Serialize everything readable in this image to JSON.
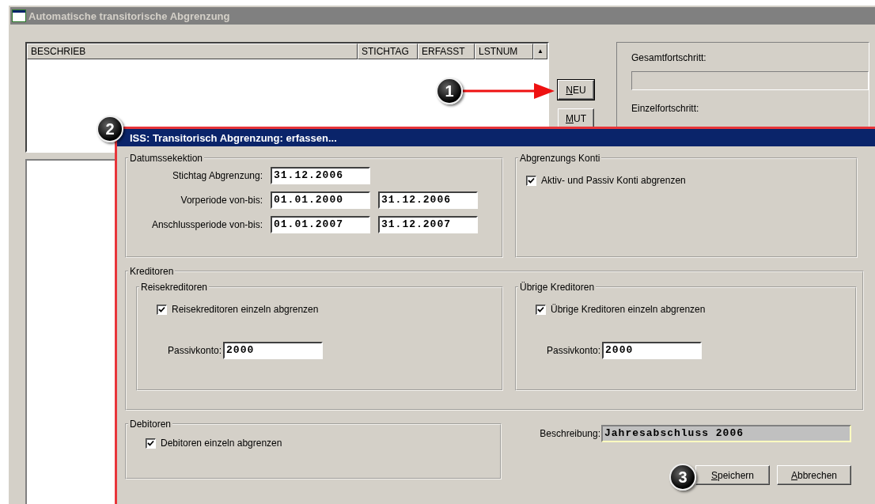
{
  "window": {
    "title": "Automatische transitorische Abgrenzung",
    "active": false
  },
  "list": {
    "columns": [
      "BESCHRIEB",
      "STICHTAG",
      "ERFASST",
      "LSTNUM"
    ],
    "scroll_up": "▲"
  },
  "side_buttons": [
    {
      "label": "NEU",
      "default": true
    },
    {
      "label": "MUT",
      "default": false
    }
  ],
  "progress": [
    {
      "label": "Gesamtfortschritt:",
      "level": 0
    },
    {
      "label": "Einzelfortschritt:"
    }
  ],
  "dialog": {
    "title": "ISS: Transitorisch Abgrenzung: erfassen...",
    "active": true,
    "dates": {
      "label": "Datumssekektion",
      "rows": [
        {
          "label": "Stichtag Abgrenzung:",
          "values": [
            "31.12.2006"
          ]
        },
        {
          "label": "Vorperiode von-bis:",
          "values": [
            "01.01.2000",
            "31.12.2006"
          ]
        },
        {
          "label": "Anschlussperiode von-bis:",
          "values": [
            "01.01.2007",
            "31.12.2007"
          ]
        }
      ]
    },
    "konti": {
      "label": "Abgrenzungs Konti",
      "checkbox": {
        "label": "Aktiv- und Passiv Konti abgrenzen",
        "checked": true
      }
    },
    "kreditoren": {
      "label": "Kreditoren",
      "groups": [
        {
          "label": "Reisekreditoren",
          "checkbox": {
            "label": "Reisekreditoren einzeln abgrenzen",
            "checked": true
          },
          "account_label": "Passivkonto:",
          "account": "2000"
        },
        {
          "label": "Übrige Kreditoren",
          "checkbox": {
            "label": "Übrige Kreditoren einzeln abgrenzen",
            "checked": true
          },
          "account_label": "Passivkonto:",
          "account": "2000"
        }
      ]
    },
    "debitoren": {
      "label": "Debitoren",
      "checkbox": {
        "label": "Debitoren einzeln abgrenzen",
        "checked": true
      }
    },
    "description": {
      "label": "Beschreibung:",
      "value": "Jahresabschluss 2006"
    },
    "buttons": [
      {
        "label": "Speichern"
      },
      {
        "label": "Abbrechen"
      }
    ]
  },
  "annotations": [
    {
      "label": "1"
    },
    {
      "label": "2"
    },
    {
      "label": "3"
    }
  ]
}
